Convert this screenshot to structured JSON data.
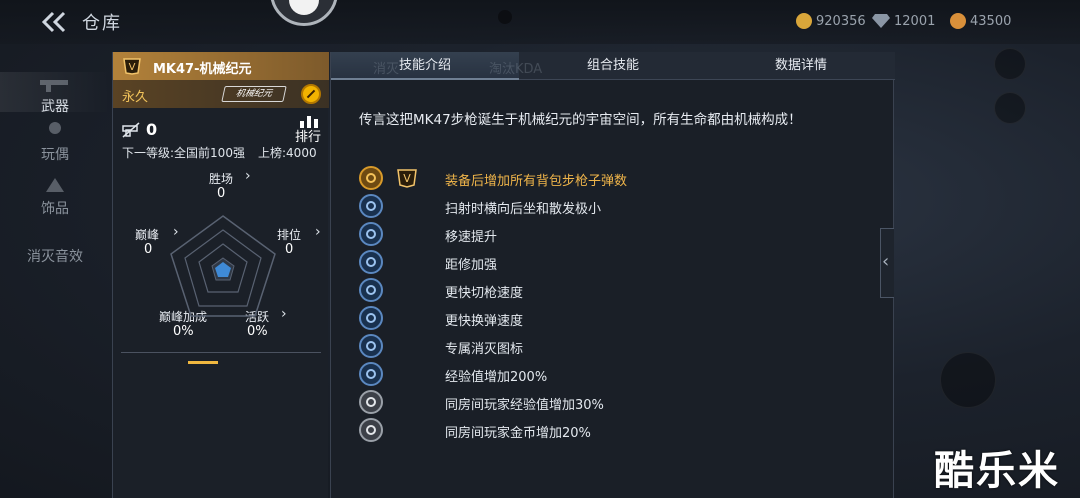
{
  "header": {
    "title": "仓库",
    "currencies": [
      {
        "icon": "gold-coin-icon",
        "value": "920356",
        "color": "#d9a63a"
      },
      {
        "icon": "diamond-icon",
        "value": "12001",
        "color": "#8a96a5"
      },
      {
        "icon": "orange-coin-icon",
        "value": "43500",
        "color": "#d9903a"
      }
    ]
  },
  "nav": {
    "items": [
      {
        "label": "武器",
        "icon": "gun-icon"
      },
      {
        "label": "玩偶",
        "icon": "figure-icon"
      },
      {
        "label": "饰品",
        "icon": "accessory-icon"
      },
      {
        "label": "消灭音效",
        "icon": "sound-icon"
      }
    ]
  },
  "weapon": {
    "name": "MK47-机械纪元",
    "duration": "永久",
    "brand_logo": "机械纪元",
    "kills": "0",
    "rank_label": "排行",
    "next_level": "下一等级:全国前100强",
    "on_board": "上榜:4000",
    "stats": {
      "wins": {
        "label": "胜场",
        "value": "0"
      },
      "rank": {
        "label": "排位",
        "value": "0"
      },
      "peak": {
        "label": "巅峰",
        "value": "0"
      },
      "peak_bonus": {
        "label": "巅峰加成",
        "value": "0%"
      },
      "active": {
        "label": "活跃",
        "value": "0%"
      }
    }
  },
  "tabs": {
    "skills": "技能介绍",
    "combo": "组合技能",
    "details": "数据详情",
    "ghost_left": "消灭",
    "ghost_right": "淘汰KDA"
  },
  "description": "传言这把MK47步枪诞生于机械纪元的宇宙空间，所有生命都由机械构成！",
  "skills": [
    {
      "label": "装备后增加所有背包步枪子弹数",
      "icon": "bullet-icon",
      "style": "gold"
    },
    {
      "label": "扫射时横向后坐和散发极小",
      "icon": "recoil-icon",
      "style": "blue"
    },
    {
      "label": "移速提升",
      "icon": "running-icon",
      "style": "blue"
    },
    {
      "label": "距修加强",
      "icon": "range-icon",
      "style": "blue"
    },
    {
      "label": "更快切枪速度",
      "icon": "swap-gun-icon",
      "style": "blue"
    },
    {
      "label": "更快换弹速度",
      "icon": "reload-icon",
      "style": "blue"
    },
    {
      "label": "专属消灭图标",
      "icon": "kill-mark-icon",
      "style": "blue"
    },
    {
      "label": "经验值增加200%",
      "icon": "exp-icon",
      "style": "blue"
    },
    {
      "label": "同房间玩家经验值增加30%",
      "icon": "room-exp-icon",
      "style": "grey"
    },
    {
      "label": "同房间玩家金币增加20%",
      "icon": "room-coin-icon",
      "style": "grey"
    }
  ],
  "watermark": "酷乐米"
}
